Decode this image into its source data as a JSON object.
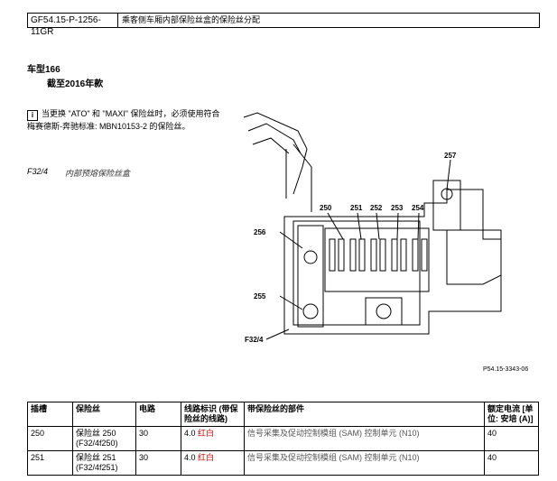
{
  "header": {
    "code": "GF54.15-P-1256-11GR",
    "title": "乘客侧车厢内部保险丝盒的保险丝分配"
  },
  "model": {
    "line1": "车型166",
    "line2": "截至2016年款"
  },
  "note": {
    "icon": "info-icon",
    "text": "当更换 \"ATO\" 和 \"MAXI\" 保险丝时，必须使用符合梅赛德斯-奔驰标准: MBN10153-2 的保险丝。"
  },
  "section": {
    "id": "F32/4",
    "desc": "内部预熔保险丝盒"
  },
  "figure": {
    "labels": {
      "l257": "257",
      "l250": "250",
      "l251": "251",
      "l252": "252",
      "l253": "253",
      "l254": "254",
      "l256": "256",
      "l255": "255",
      "lf32": "F32/4"
    },
    "ref": "P54.15-3343-06"
  },
  "table": {
    "headers": [
      "插槽",
      "保险丝",
      "电路",
      "线路标识 (带保险丝的线路)",
      "带保险丝的部件",
      "额定电流 [单位: 安培 (A)]"
    ],
    "rows": [
      {
        "slot": "250",
        "fuse": "保险丝 250",
        "fuse_sub": "(F32/4f250)",
        "circuit": "30",
        "wire": "4.0",
        "wire_color": "红白",
        "component": "信号采集及促动控制模组 (SAM) 控制单元 (N10)",
        "rating": "40"
      },
      {
        "slot": "251",
        "fuse": "保险丝 251",
        "fuse_sub": "(F32/4f251)",
        "circuit": "30",
        "wire": "4.0",
        "wire_color": "红白",
        "component": "信号采集及促动控制模组 (SAM) 控制单元 (N10)",
        "rating": "40"
      }
    ]
  }
}
